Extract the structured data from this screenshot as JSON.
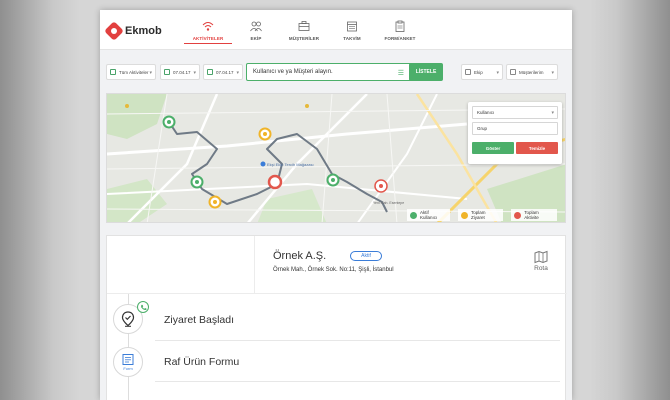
{
  "app": {
    "brand": "Ekmob",
    "accent": "#e2403f",
    "green": "#4caf6a"
  },
  "nav": [
    {
      "label": "AKTİVİTELER",
      "icon": "wifi-signal-icon",
      "active": true
    },
    {
      "label": "EKİP",
      "icon": "team-icon",
      "active": false
    },
    {
      "label": "MÜŞTERİLER",
      "icon": "briefcase-icon",
      "active": false
    },
    {
      "label": "TAKVİM",
      "icon": "calendar-icon",
      "active": false
    },
    {
      "label": "FORM/ANKET",
      "icon": "clipboard-icon",
      "active": false
    }
  ],
  "toolbar": {
    "activity_filter": "Tüm Aktiviteler",
    "date_start": "07.04.17",
    "date_end": "07.04.17",
    "search_value": "Kullanıcı ve ya Müşteri alayın.",
    "list_button": "LİSTELE",
    "team_select": "Ekip",
    "customer_select": "Müşterilerim"
  },
  "map_panel": {
    "user_select": "Kullanıcı",
    "group_field": "Grup",
    "show_button": "Göster",
    "clear_button": "Temizle"
  },
  "map_labels": {
    "poi": "Ekşi Ekip Tercih Mağazası",
    "district": "Yeni Mah. Esentepe"
  },
  "legend": [
    {
      "label": "Aktif Kullanıcı",
      "color": "#4caf6a"
    },
    {
      "label": "Toplam Ziyaret",
      "color": "#f0b429"
    },
    {
      "label": "Toplam Aktivite",
      "color": "#e2574c"
    }
  ],
  "customer": {
    "name": "Örnek A.Ş.",
    "status": "Aktif",
    "address": "Örnek Mah., Örnek Sok. No:11, Şişli, İstanbul",
    "route_label": "Rota"
  },
  "activities": [
    {
      "title": "Ziyaret Başladı",
      "icon": "location-check-icon"
    },
    {
      "title": "Raf Ürün Formu",
      "icon": "form-icon",
      "icon_caption": "Form"
    }
  ]
}
